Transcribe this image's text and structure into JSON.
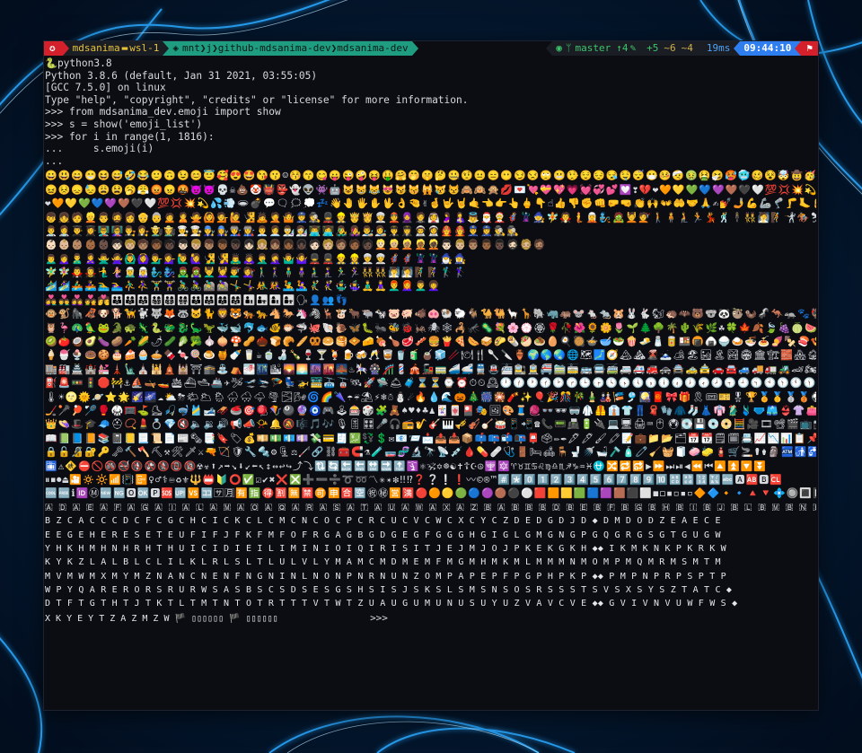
{
  "prompt": {
    "user_host": "mdsanima",
    "host": "wsl-1",
    "path_segments": [
      "mnt",
      "j",
      "github-mdsanima-dev",
      "mdsanima-dev"
    ],
    "git_branch": "master",
    "git_ahead": "4",
    "git_added": "+5",
    "git_modified": "~6",
    "git_deleted": "~4",
    "duration": "19ms",
    "time": "09:44:10"
  },
  "terminal": {
    "venv_line": "python3.8",
    "lines": [
      "Python 3.8.6 (default, Jan 31 2021, 03:55:05)",
      "[GCC 7.5.0] on linux",
      "Type \"help\", \"copyright\", \"credits\" or \"license\" for more information.",
      ">>> from mdsanima_dev.emoji import show",
      ">>> s = show('emoji_list')",
      ">>> for i in range(1, 1816):",
      "...     s.emoji(i)",
      "..."
    ],
    "emoji_rows": [
      "😀😃😄😁😆😅🤣😂🙂🙃😉😊😇🥰😍🤩😘😗☺😚😙😋😛😜🤪😝🤑🤗🤭🤫🤔🤐🤨😐😑😶😏😒🙄😬🤥😌😔😪🤤😴😷🤒🤕🤢🤮🤧🥵🥶🥴😵🤯🤠🥳😎🤓🧐😕😟🙁☹😮😯😲😳🥺😦😧😨😰😥😢😭😱",
      "😖😣😞😓😩😫🥱😤😡😠🤬😈👿💀☠💩🤡👹👺👻👽👾🤖😺😸😹😻😼😽🙀😿😾🙈🙉🙊💋💌💘💝💖💗💓💞💕💟❣💔❤🧡💛💚💙💜🤎🖤🤍💯💢💥💫💦💨🕳💣💬👁🗨🗯💭💤👋🤚🖐✋🖖",
      "❤🧡💛💚💙💜🤎🖤🤍💯💢💥💫💦💨🕳💣💬🗨🗯💭💤👋🤚🖐✋🖖👌🤏✌🤞🤟🤘🤙👈👉👆🖕👇☝👍👎✊👊🤛🤜👏🙌👐🤲🤝🙏✍💅🤳💪🦾🦿🦵🦶👂🦻👃🧠🦷🦴👀👁👅👄👶🧒",
      "👦👧🧑👱👨🧔👩👴👵🙍🙎🙅🙆💁🙋🧏🙇🤦🤷👮🕵💂👷🤴👸👳👲🧕🤵👰🤰🤱👼🎅🤶🦸🦹🧙🧚🧛🧜🧝🧞🧟💆💇🚶🧍🧎🏃💃🕺🕴👯🧖🧗🤺🏇⛷🏂🏌🏄🚣🏊⛹🏋🚴🚵🤸🤼🤽🤾",
      "👨‍⚕👩‍⚕👨‍🎓👩‍🎓👨‍🏫👩‍🏫👨‍⚖👩‍⚖👨‍🌾👩‍🌾👨‍🍳👩‍🍳👨‍🔧👩‍🔧👨‍🏭👩‍🏭👨‍💼👩‍💼👨‍🔬👩‍🔬👨‍💻👩‍💻👨‍🎤👩‍🎤👨‍🎨👩‍🎨👨‍✈👩‍✈👨‍🚀👩‍🚀👨‍🚒👩‍🚒👮‍♂👮‍♀🕵‍♂🕵‍♀",
      "👶🏻👶🏼👶🏽👶🏾👶🏿🧒🏻🧒🏼🧒🏽🧒🏾🧒🏿👦🏻👦🏼👦🏽👦🏾👦🏿👧🏻👧🏼👧🏽👧🏾👧🏿🧑🏻🧑🏼🧑🏽🧑🏾🧑🏿👱🏻👱🏼👱🏽👱🏾👱🏿👨🏻👨🏼👨🏽👨🏾👨🏿🧔🏻🧔🏼🧔🏽",
      "🙍‍♂🙍‍♀🙎‍♂🙎‍♀🙅‍♂🙅‍♀🙆‍♂🙆‍♀💁‍♂💁‍♀🙋‍♂🙋‍♀🧏‍♂🧏‍♀🙇‍♂🙇‍♀🤦‍♂🤦‍♀🤷‍♂🤷‍♀💂‍♂💂‍♀👷‍♂👷‍♀👳‍♂👳‍♀🦸‍♂🦸‍♀🦹‍♂🦹‍♀🧙‍♂🧙‍♀",
      "🧚‍♂🧚‍♀🧛‍♂🧛‍♀🧜‍♂🧜‍♀🧝‍♂🧝‍♀🧞‍♂🧞‍♀🧟‍♂🧟‍♀💆‍♂💆‍♀💇‍♂💇‍♀🚶‍♂🚶‍♀🧍‍♂🧍‍♀🧎‍♂🧎‍♀🏃‍♂🏃‍♀👯‍♂👯‍♀🧖‍♂🧖‍♀🧗‍♂🧗‍♀🏌‍♂🏌‍♀",
      "🏄‍♂🏄‍♀🚣‍♂🚣‍♀🏊‍♂🏊‍♀⛹‍♂⛹‍♀🏋‍♂🏋‍♀🚴‍♂🚴‍♀🚵‍♂🚵‍♀🤸‍♂🤸‍♀🤼‍♂🤼‍♀🤽‍♂🤽‍♀🤾‍♂🤾‍♀🤹‍♂🤹‍♀🧘‍♂🧘‍♀👨‍🦰👩‍🦰👨‍🦱👩‍🦱",
      "👩‍❤‍👨👨‍❤‍👨👩‍❤‍👩💑💏👪👨‍👩‍👦👨‍👩‍👧👨‍👩‍👧‍👦👨‍👩‍👦‍👦👨‍👩‍👧‍👧👨‍👨‍👦👨‍👨‍👧👩‍👩‍👦👩‍👩‍👧👨‍👦👨‍👧👩‍👦👩‍👧🗣👤👥👣",
      "🐵🐒🦍🦧🐶🐕🦮🐩🐺🦊🦝🐱🐈🦁🐯🐅🐆🐴🐎🦄🦓🦌🐮🐂🐃🐄🐷🐖🐗🐽🐏🐑🐐🐪🐫🦙🦒🐘🦏🦛🐭🐁🐀🐹🐰🐇🐿🦔🦇🐻🐨🐼🦥🦦🦨🦘🦡🐾🦃🐔🐓🐣🐤🐥🐦🐧🕊🦅🦆🦢",
      "🦉🦩🦚🦜🐸🐊🐢🦎🐍🐲🐉🦕🦖🐳🐋🐬🐟🐠🐡🦈🐙🐚🐌🦋🐛🐜🐝🐞🦗🕷🕸🦂🦟🦠💐🌸💮🏵🌹🥀🌺🌻🌼🌷🌱🌲🌳🌴🌵🌾🌿☘🍀🍁🍂🍃🍇🍈🍉🍊🍋🍌🍍🥭🍎🍏🍐🍑🍒🍓",
      "🥝🍅🥥🥑🍆🥔🥕🌽🌶🥒🥬🥦🧄🧅🍄🥜🌰🍞🥐🥖🥨🥯🥞🧇🧀🍖🍗🥩🥓🍔🍟🍕🌭🥪🌮🌯🥙🧆🥚🍳🥘🍲🥣🥗🍿🧈🧂🥫🍱🍘🍙🍚🍛🍜🍝🍠🍢🍣🍤🍥🥮🍡🥟🥠🥡🦀🦞🦐🦑🦪",
      "🍦🍧🍨🍩🍪🎂🍰🧁🥧🍫🍬🍭🍮🍯🍼🥛☕🍵🍶🍾🍷🍸🍹🍺🍻🥂🥃🥤🧃🧉🧊🥢🍽🍴🥄🔪🏺🌍🌎🌏🌐🗺🗾🧭🏔⛰🌋🗻🏕🏖🏜🏝🏞🏟🏛🏗🧱🏘🏚🏠🏡🏢🏣🏤🏥🏦🏨🏩🏪🏫",
      "🏬🏭🏯🏰💒🗼🗽⛪🕌🛕🕍⛩🕋⛲⛺🌁🌃🏙🌄🌅🌆🌇🌉♨🎠🎡🎢💈🎪🚂🚃🚄🚅🚆🚇🚈🚉🚊🚝🚞🚋🚌🚍🚎🚐🚑🚒🚓🚔🚕🚖🚗🚘🚙🚚🚛🚜🏎🏍🛵🦽🦼🛺🚲🛴🛹🚏🛣🛤🛢",
      "⛽🚨🚥🚦🛑🚧⚓⛵🛶🚤🛳⛴🛥🚢✈🛩🛫🛬🪂💺🚁🚟🚠🚡🛰🚀🛸🛎🧳⌛⏳⌚⏰⏱⏲🕰🕛🕧🕐🕜🕑🕝🕒🕞🕓🕟🕔🕠🕕🕡🕖🕢🕗🕣🕘🕤🕙🕥🕚🕦🌑🌒🌓🌔🌕🌖🌗🌘🌙🌚🌛🌜",
      "🌡☀🌝🌞🪐⭐🌟🌠🌌☁⛅⛈🌤🌥🌦🌧🌨🌩🌪🌫🌬🌀🌈🌂☂☔⛱⚡❄☃⛄☄🔥💧🌊🎃🎄🎆🎇🧨✨🎈🎉🎊🎋🎍🎎🎏🎐🎑🧧🎀🎁🎗🎟🎫🎖🏆🏅🥇🥈🥉⚽⚾🥎🏀🏐🏈🏉🎾🥏🎳🏏🏑",
      "🏒🥍🏓🏸🥊🥋🥅⛳⛸🎣🤿🎽🎿🛷🥌🎯🪀🪁🎱🔮🧿🎮🕹🎰🎲🧩🧸♠♥♦♣♟🃏🀄🎴🎭🖼🎨🧵🧶👓🕶🥽🥼🦺👔👕👖🧣🧤🧥🧦👗👘🥻🩱🩲🩳👙👚👛👜👝🛍🎒👞👟🥾🥿👠👡🩰👢",
      "👑👒🎩🎓🧢⛑📿💄💍💎🔇🔈🔉🔊📢📣📯🔔🔕🎼🎵🎶🎙🎚🎛🎤🎧📻🎷🎸🎹🎺🎻🪕🥁📱📲☎📞📟📠🔋🔌💻🖥🖨⌨🖱🖲💽💾💿📀🧮🎥🎞📽🎬📺📷📸📹📼🔍🔎🕯💡🔦🏮🪔📔📕",
      "📖📗📘📙📚📓📒📃📜📄📰🗞📑🔖🏷💰💴💵💶💷💸💳🧾💹💱💲✉📧📨📩📤📥📦📫📪📬📭📮🗳✏✒🖋🖊🖌🖍📝💼📁📂🗂📅📆🗒🗓📇📈📉📊📋📌📍📎🖇📏📐✂🗃🗄🗑",
      "🔒🔓🔏🔐🔑🗝🔨🪓⛏⚒🛠🗡⚔🔫🏹🛡🔧🔩⚙🗜⚖🦯🔗⛓🧰🧲⚗🧪🧫🧬🔬🔭📡💉🩸💊🩹🩺🚪🛏🛋🪑🚽🚿🛁🪒🧴🧷🧹🧺🧻🧼🧽🧯🛒🚬⚰⚱🗿🏧🚮🚰♿🚹🚺🚻🚼🚾🛂🛃🛄",
      "🛅⚠🚸⛔🚫🚳🚭🚯🚱🚷📵🔞☢☣⬆↗➡↘⬇↙⬅↖↕↔↩↪⤴⤵🔃🔄🔙🔚🔛🔜🔝🛐⚛🕉✡☸☯✝☦☪☮🕎🔯♈♉♊♋♌♍♎♏♐♑♒♓⛎🔀🔁🔂▶⏩⏭⏯◀⏪⏮🔼⏫🔽⏬",
      "⏸⏹⏺⏏🎦🔅🔆📶📳📴♀♂⚕♾♻⚜🔱📛🔰⭕✅☑✔✖❌❎➕➖➗➰➿〽✳✴❇‼⁉❓❔❕❗〰©®™#️⃣*️⃣0️⃣1️⃣2️⃣3️⃣4️⃣5️⃣6️⃣7️⃣8️⃣9️⃣🔟🔠🔡🔢🔣🔤🅰🆎🅱🆑",
      "🆒🆓ℹ🆔Ⓜ🆕🆖🅾🆗🅿🆘🆙🆚🈁🈂🈷🈶🈯🉐🈹🈚🈲🉑🈸🈴🈳㊗㊙🈺🈵🔴🟠🟡🟢🔵🟣🟤⚫⚪🟥🟧🟨🟩🟦🟪🟫⬛⬜◼◻◾◽▪▫🔶🔷🔸🔹🔺🔻💠🔘🔳🔲🏁🚩🎌🏴🏳🏳‍🌈🏴‍☠🇦🇨"
    ],
    "letter_rows": [
      "🇦 🇩 🇦 🇪 🇦 🇫 🇦 🇬 🇦 🇮 🇦 🇱 🇦 🇲 🇦 🇴 🇦 🇶 🇦 🇷 🇦 🇸 🇦 🇹 🇦 🇺 🇦 🇼 🇦 🇽 🇦 🇿 🇧 🇦 🇧 🇧 🇧 🇩 🇧 🇪 🇧 🇫 🇧 🇬 🇧 🇭 🇧 🇮 🇧 🇯 🇧 🇱 🇧 🇲 🇧 🇳 🇧 🇴 🇧 🇶 🇧 🇷 🇧 🇸 🇧 🇹 🇧 🇻 🇧 🇼 🇧 🇾",
      "B Z C A C C C D C F C G C H C I C K C L C M C N C O C P C R C U C V C W C X C Y C Z D E D G D J D ◆ D M D O D Z E A E C E",
      "E E G E H E R E S E T E U F I F J F K F M F O F R G A G B G D G E G F G G G H G I G L G M G N G P G Q G R G S G T G U G W",
      "Y H K H M H N H R H T H U I C I D I E I L I M I N I O I Q I R I S I T J E J M J O J P K E K G K H ◆◆ I K M K N K P K R K W",
      "K Y K Z L A L B L C L I L K L R L S L T L U L V L Y M A M C M D M E M F M G M H M K M L M M M N M O M P M Q M R M S M T M",
      "M V M W M X M Y M Z N A N C N E N F N G N I N L N O N P N R N U N Z O M P A P E P F P G P H P K P ◆◆ P M P N P R P S P T P",
      "W P Y Q A R E R O R S R U R W S A S B S C S D S E S G S H S I S J S K S L S M S N S O S R S S S T S V S X S Y S Z T A T C ◆",
      "D T F T G T H T J T K T L T M T N T O T R T T T V T W T Z U A U G U M U N U S U Y U Z V A V C V E ◆◆ G V I V N V U W F W S ◆",
      "X K Y E Y T Z A Z M Z W 🏴 ▯▯▯▯▯▯ 🏴 ▯▯▯▯▯▯"
    ],
    "final_prompt": ">>>"
  },
  "colors": {
    "os_segment": "#d4202b",
    "path_segment": "#1f9d80",
    "time_segment": "#2f7ef0",
    "git_text": "#3cc46a",
    "terminal_bg": "#0b0d12",
    "wallpaper_bg": "#03142a",
    "wave_glow": "#2aa8ff"
  },
  "icons": {
    "os": "ubuntu-icon",
    "path": "folder-icon",
    "git": "github-icon",
    "branch": "branch-icon",
    "clock": "clock-icon"
  }
}
